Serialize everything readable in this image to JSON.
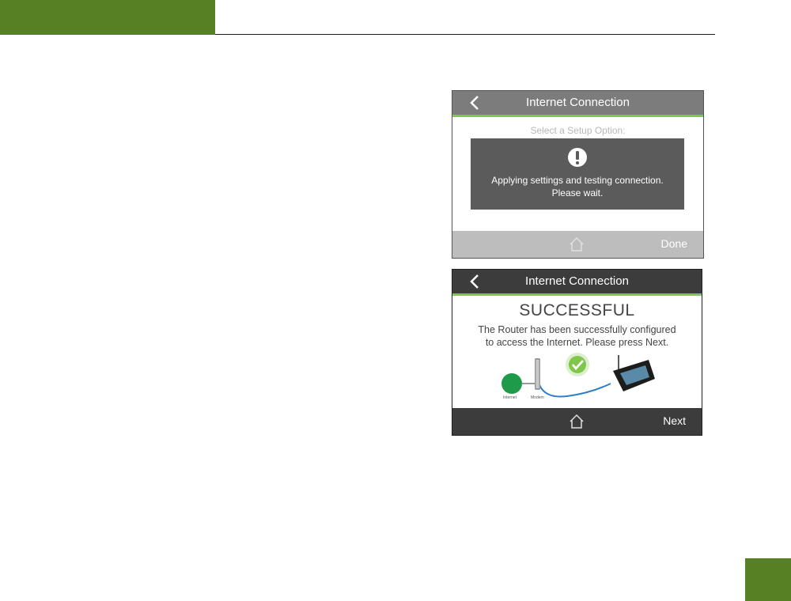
{
  "screens": [
    {
      "title": "Internet Connection",
      "subtitle": "Select a Setup Option:",
      "dialog_line1": "Applying settings and testing connection.",
      "dialog_line2": "Please wait.",
      "action": "Done"
    },
    {
      "title": "Internet Connection",
      "heading": "SUCCESSFUL",
      "line1": "The Router has been successfully configured",
      "line2": "to access the Internet. Please press Next.",
      "label_internet": "Internet",
      "label_modem": "Modem",
      "action": "Next"
    }
  ],
  "colors": {
    "brand_green": "#558023",
    "accent_green": "#7fc64a"
  }
}
